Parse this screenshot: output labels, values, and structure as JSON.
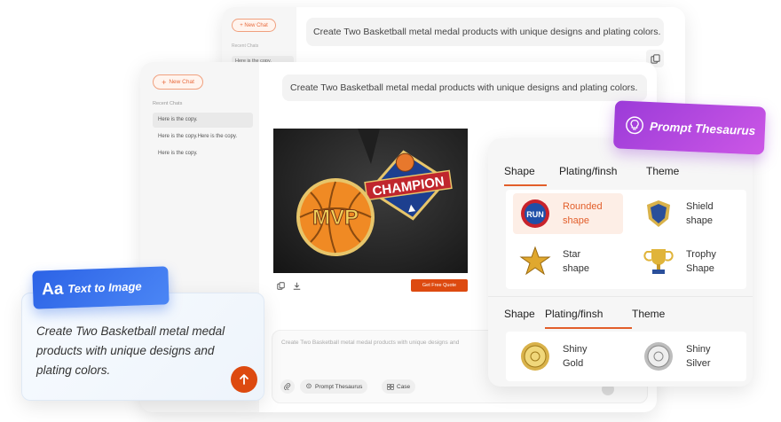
{
  "back_window": {
    "new_chat": "New Chat",
    "recent_label": "Recent Chats",
    "history": [
      "Here is the copy."
    ],
    "prompt": "Create Two Basketball metal medal products with unique designs and plating colors."
  },
  "main_window": {
    "new_chat": "New Chat",
    "recent_label": "Recent Chats",
    "history": [
      "Here is the copy.",
      "Here is the copy.Here is the copy.",
      "Here is the copy."
    ],
    "prompt": "Create Two Basketball metal medal products with unique designs and plating colors.",
    "image_text": {
      "mvp": "MVP",
      "champion": "CHAMPION"
    },
    "get_quote": "Get Free Quote",
    "input_placeholder": "Create Two Basketball metal medal products with unique designs and",
    "chips": {
      "thesaurus": "Prompt Thesaurus",
      "case": "Case"
    }
  },
  "thesaurus_badge": {
    "label": "Prompt Thesaurus",
    "icon": "lightbulb-icon"
  },
  "thesaurus": {
    "tabs": [
      "Shape",
      "Plating/finsh",
      "Theme"
    ],
    "shape_section": {
      "active_tab": 0,
      "options": [
        {
          "line1": "Rounded",
          "line2": "shape",
          "selected": true
        },
        {
          "line1": "Shield",
          "line2": "shape",
          "selected": false
        },
        {
          "line1": "Star",
          "line2": "shape",
          "selected": false
        },
        {
          "line1": "Trophy",
          "line2": "Shape",
          "selected": false
        }
      ]
    },
    "plating_section": {
      "active_tab": 1,
      "options": [
        {
          "line1": "Shiny",
          "line2": "Gold",
          "selected": false
        },
        {
          "line1": "Shiny",
          "line2": "Silver",
          "selected": false
        }
      ]
    }
  },
  "text_to_image": {
    "badge_aa": "Aa",
    "badge_label": "Text to Image",
    "description": "Create Two Basketball metal medal products with unique designs and plating colors."
  },
  "colors": {
    "accent": "#dd4a10",
    "purple": "#b04ae0",
    "blue": "#2c63e6"
  }
}
